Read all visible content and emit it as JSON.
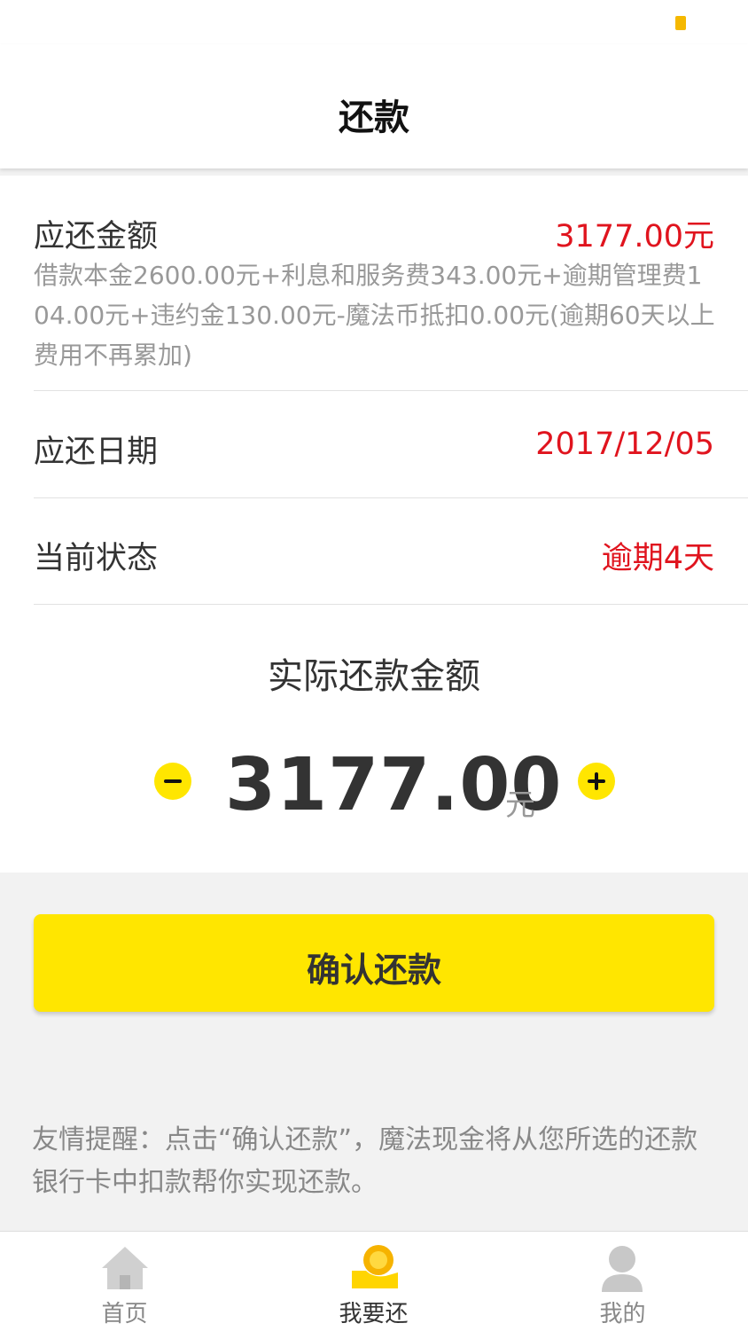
{
  "header": {
    "title": "还款"
  },
  "summary": {
    "due_amount_label": "应还金额",
    "due_amount_value": "3177.00元",
    "due_amount_detail": "借款本金2600.00元+利息和服务费343.00元+逾期管理费104.00元+违约金130.00元-魔法币抵扣0.00元(逾期60天以上费用不再累加)",
    "due_date_label": "应还日期",
    "due_date_value": "2017/12/05",
    "status_label": "当前状态",
    "status_value": "逾期4天"
  },
  "actual": {
    "title": "实际还款金额",
    "amount": "3177.00",
    "unit": "元"
  },
  "confirm_button": {
    "label": "确认还款"
  },
  "tip": "友情提醒：点击“确认还款”，魔法现金将从您所选的还款银行卡中扣款帮你实现还款。",
  "tabbar": {
    "items": [
      {
        "label": "首页",
        "icon": "home-icon"
      },
      {
        "label": "我要还",
        "icon": "repay-icon",
        "active": true
      },
      {
        "label": "我的",
        "icon": "user-icon"
      }
    ]
  },
  "colors": {
    "accent": "#ffe600",
    "alert": "#e0141e",
    "battery": "#f5b800"
  }
}
